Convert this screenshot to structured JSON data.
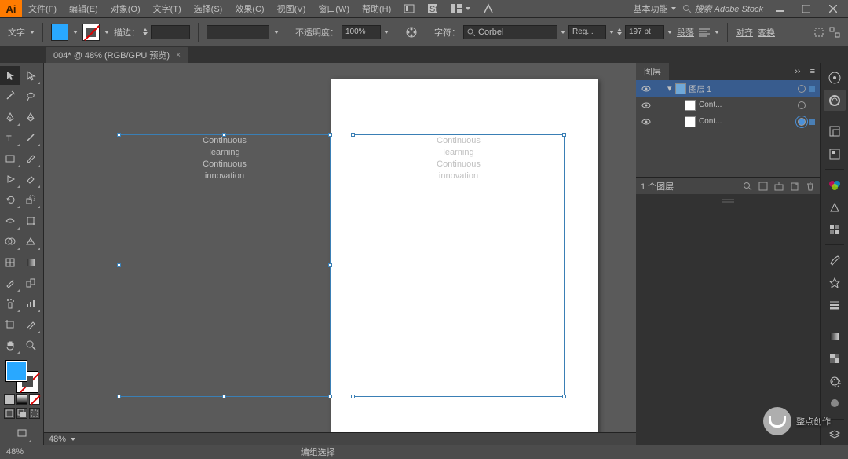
{
  "app": {
    "logo": "Ai"
  },
  "menu": {
    "file": "文件(F)",
    "edit": "编辑(E)",
    "object": "对象(O)",
    "type": "文字(T)",
    "select": "选择(S)",
    "effect": "效果(C)",
    "view": "视图(V)",
    "window": "窗口(W)",
    "help": "帮助(H)"
  },
  "workspace_label": "基本功能",
  "search_placeholder": "搜索 Adobe Stock",
  "tool_label": "文字",
  "controlbar": {
    "stroke_label": "描边：",
    "stroke_input": "",
    "opacity_label": "不透明度：",
    "opacity_value": "100%",
    "char_label": "字符：",
    "font_name": "Corbel",
    "font_style": "Reg...",
    "font_size": "197 pt",
    "paragraph": "段落",
    "align": "对齐",
    "transform": "变换"
  },
  "document_tab": "004* @ 48% (RGB/GPU 预览)",
  "canvas": {
    "text_lines": [
      "Continuous",
      "learning",
      "Continuous",
      "innovation"
    ],
    "zoom": "48%"
  },
  "layers_panel": {
    "title": "图层",
    "rows": [
      {
        "name": "图层 1",
        "indent": 0,
        "selected": true,
        "target": "plain"
      },
      {
        "name": "Cont...",
        "indent": 1,
        "selected": false,
        "target": "plain"
      },
      {
        "name": "Cont...",
        "indent": 1,
        "selected": false,
        "target": "dbl"
      }
    ],
    "footer_count": "1 个图层"
  },
  "status": {
    "zoom": "48%",
    "hint": "编组选择"
  },
  "watermark": "整点创作"
}
